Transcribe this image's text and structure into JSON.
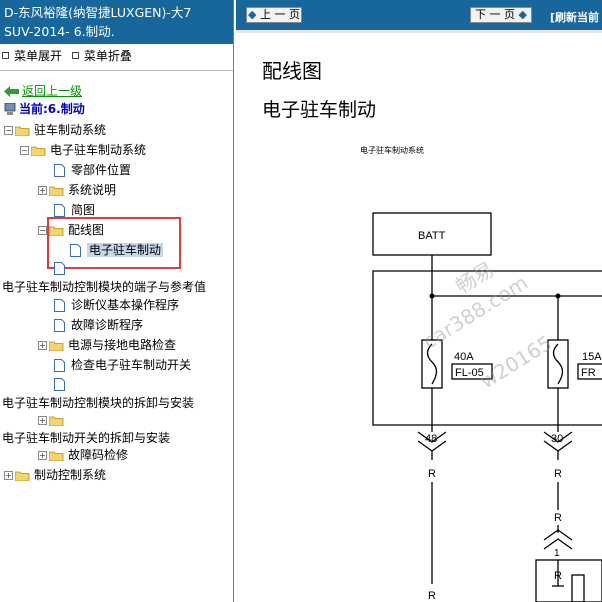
{
  "left": {
    "title_line1": "D-东风裕隆(纳智捷LUXGEN)-大7",
    "title_line2": "SUV-2014- 6.制动.",
    "menu": {
      "expand": "菜单展开",
      "collapse": "菜单折叠"
    },
    "back": "返回上一级",
    "current": "当前:6.制动",
    "tree": {
      "parking_brake_system": "驻车制动系统",
      "electronic_parking_brake_system": "电子驻车制动系统",
      "parts_location": "零部件位置",
      "system_description": "系统说明",
      "schematic": "简图",
      "wiring_diagram": "配线图",
      "electronic_parking_brake": "电子驻车制动",
      "module_terminals": "电子驻车制动控制模块的端子与参考值",
      "diag_tool_basic": "诊断仪基本操作程序",
      "fault_diag": "故障诊断程序",
      "power_ground_check": "电源与接地电路检查",
      "check_switch": "检查电子驻车制动开关",
      "module_removal": "电子驻车制动控制模块的拆卸与安装",
      "switch_removal": "电子驻车制动开关的拆卸与安装",
      "dtc_check": "故障码检修",
      "brake_control_system": "制动控制系统"
    }
  },
  "right": {
    "prev_label": "上 一 页",
    "next_label": "下 一 页",
    "refresh_label": "[刷新当前",
    "heading1": "配线图",
    "heading2": "电子驻车制动",
    "diagram_caption": "电子驻车制动系统",
    "diagram": {
      "batt": "BATT",
      "fuse1_rating": "40A",
      "fuse1_code": "FL-05",
      "fuse2_rating": "15A",
      "fuse2_code": "FR",
      "term1": "48",
      "term2": "30",
      "wire_r1": "R",
      "wire_r2": "R",
      "wire_r3": "R",
      "wire_r4": "R",
      "wire_r5": "R",
      "connector_pin": "1"
    },
    "watermark": {
      "w1": "畅易",
      "w2": "car388.com",
      "w3": "w20165"
    }
  }
}
